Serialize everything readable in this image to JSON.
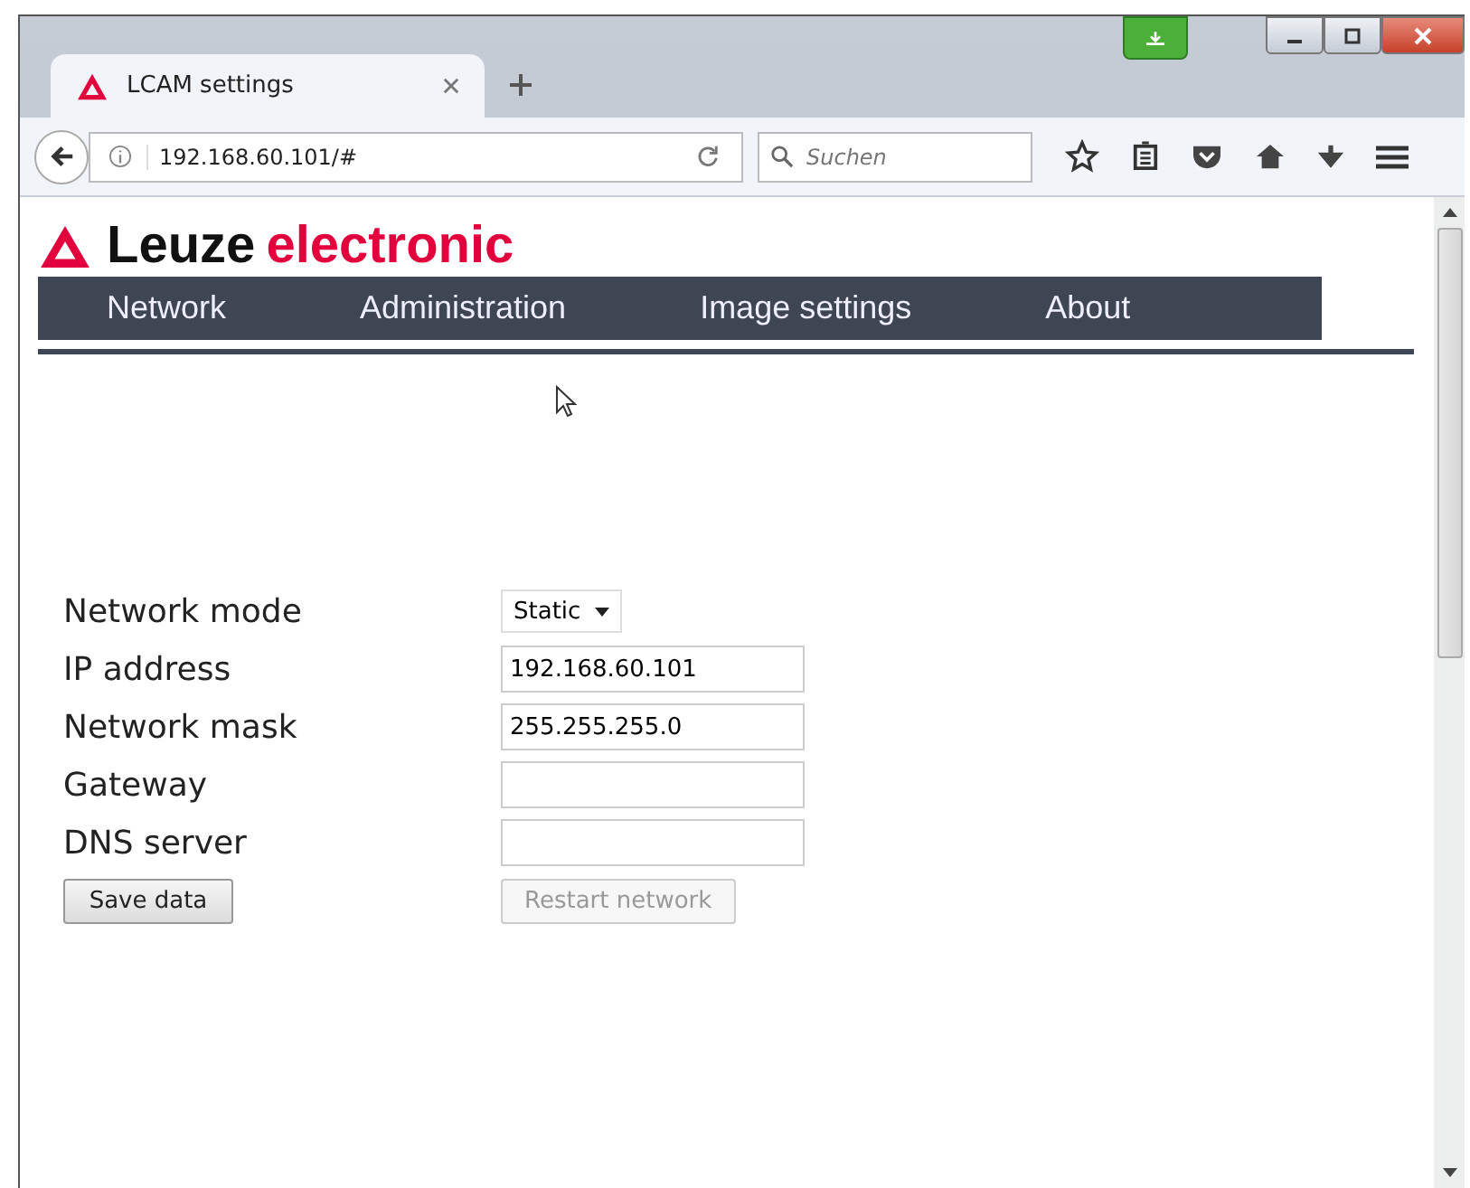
{
  "browser": {
    "tab": {
      "title": "LCAM settings"
    },
    "address": "192.168.60.101/#",
    "search": {
      "placeholder": "Suchen"
    }
  },
  "brand": {
    "name": "Leuze",
    "suffix": "electronic"
  },
  "nav": [
    {
      "label": "Network"
    },
    {
      "label": "Administration"
    },
    {
      "label": "Image settings"
    },
    {
      "label": "About"
    }
  ],
  "form": {
    "rows": [
      {
        "kind": "select",
        "label": "Network mode",
        "value": "Static"
      },
      {
        "kind": "input",
        "label": "IP address",
        "value": "192.168.60.101"
      },
      {
        "kind": "input",
        "label": "Network mask",
        "value": "255.255.255.0"
      },
      {
        "kind": "input",
        "label": "Gateway"
      },
      {
        "kind": "input",
        "label": "DNS server"
      }
    ],
    "buttons": [
      {
        "label": "Save data",
        "disabled": false
      },
      {
        "label": "Restart network",
        "disabled": true
      }
    ]
  }
}
